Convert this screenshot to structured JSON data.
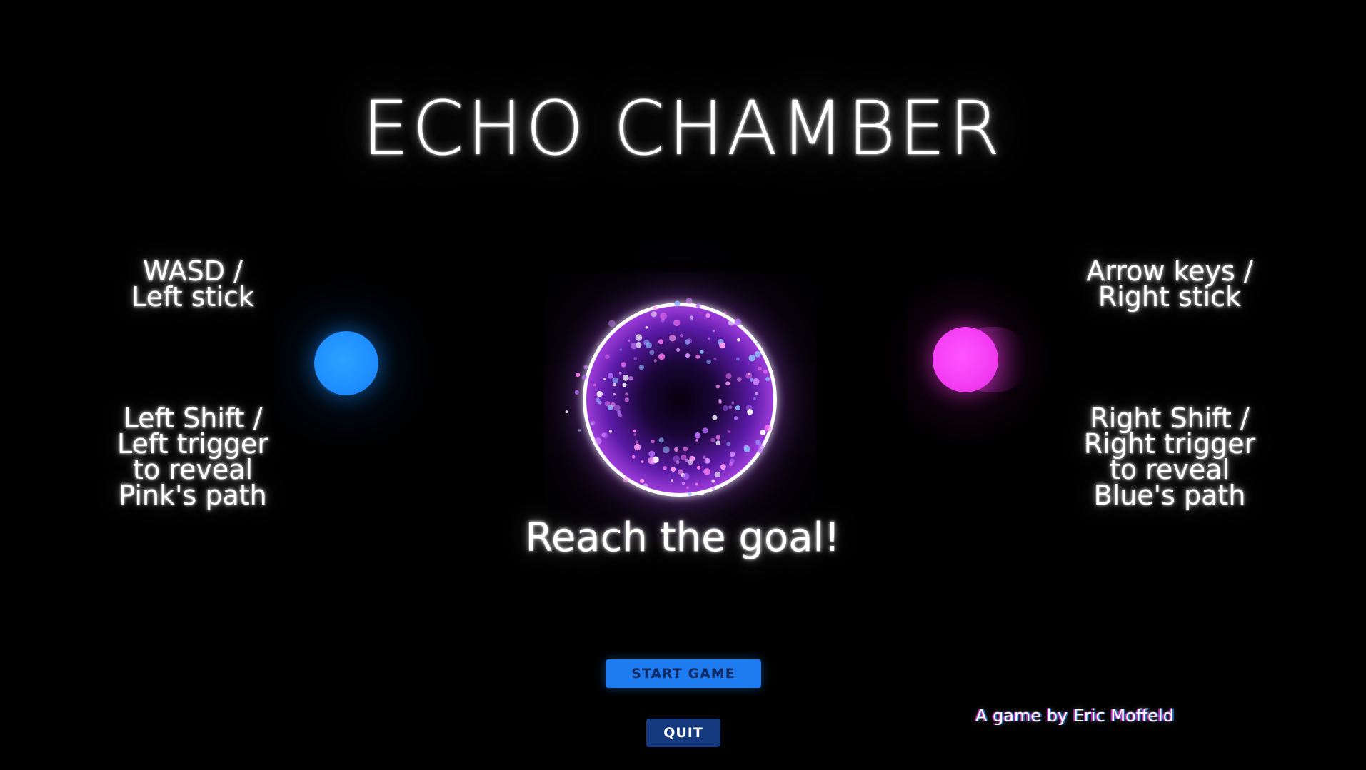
{
  "title": "ECHO CHAMBER",
  "instructions": {
    "left_move": "WASD /\nLeft stick",
    "left_reveal": "Left Shift /\nLeft trigger\nto reveal\nPink's path",
    "right_move": "Arrow keys /\nRight stick",
    "right_reveal": "Right Shift /\nRight trigger\nto reveal\nBlue's path"
  },
  "goal_text": "Reach the goal!",
  "buttons": {
    "start": "START GAME",
    "quit": "QUIT"
  },
  "credit": "A game by Eric Moffeld",
  "colors": {
    "background": "#000000",
    "blue_player": "#1f8eff",
    "pink_player": "#f43cf2",
    "goal_ring": "#ffffff",
    "goal_glow": "#b045e8",
    "start_button": "#1f7cf0",
    "quit_button": "#153a80"
  },
  "icons": {
    "blue_player": "blue-orb-icon",
    "pink_player": "pink-orb-icon",
    "goal": "goal-portal-icon"
  }
}
